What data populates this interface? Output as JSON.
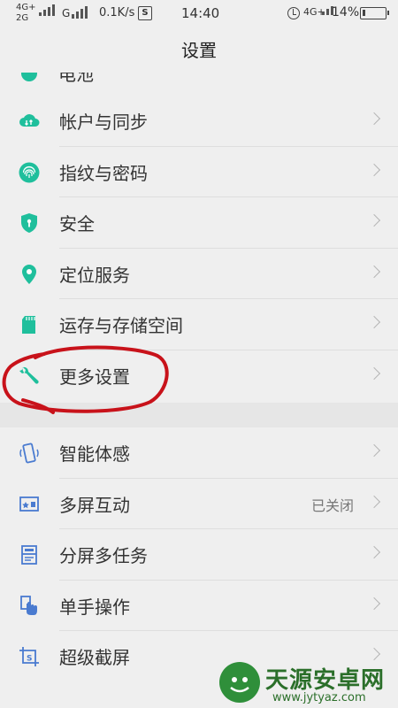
{
  "status_bar": {
    "network_top": "4G+",
    "network_bottom": "2G",
    "network_g": "G",
    "speed": "0.1K/s",
    "app_badge": "S",
    "time": "14:40",
    "network_right": "4G+",
    "battery_percent": "14%",
    "battery_level": 0.14
  },
  "header": {
    "title": "设置"
  },
  "partial_item": {
    "label": "电池"
  },
  "group1": [
    {
      "label": "帐户与同步",
      "icon": "cloud-sync-icon",
      "status": ""
    },
    {
      "label": "指纹与密码",
      "icon": "fingerprint-icon",
      "status": ""
    },
    {
      "label": "安全",
      "icon": "shield-icon",
      "status": ""
    },
    {
      "label": "定位服务",
      "icon": "location-pin-icon",
      "status": ""
    },
    {
      "label": "运存与存储空间",
      "icon": "sd-card-icon",
      "status": ""
    },
    {
      "label": "更多设置",
      "icon": "wrench-icon",
      "status": ""
    }
  ],
  "group2": [
    {
      "label": "智能体感",
      "icon": "motion-phone-icon",
      "status": ""
    },
    {
      "label": "多屏互动",
      "icon": "multi-screen-icon",
      "status": "已关闭"
    },
    {
      "label": "分屏多任务",
      "icon": "split-screen-icon",
      "status": ""
    },
    {
      "label": "单手操作",
      "icon": "one-hand-icon",
      "status": ""
    },
    {
      "label": "超级截屏",
      "icon": "screenshot-icon",
      "status": ""
    }
  ],
  "colors": {
    "teal_icon": "#1fbf9c",
    "blue_icon": "#4a7bd0",
    "annotation_red": "#c8121a",
    "background": "#efefef"
  },
  "watermark": {
    "title": "天源安卓网",
    "url": "www.jytyaz.com"
  }
}
